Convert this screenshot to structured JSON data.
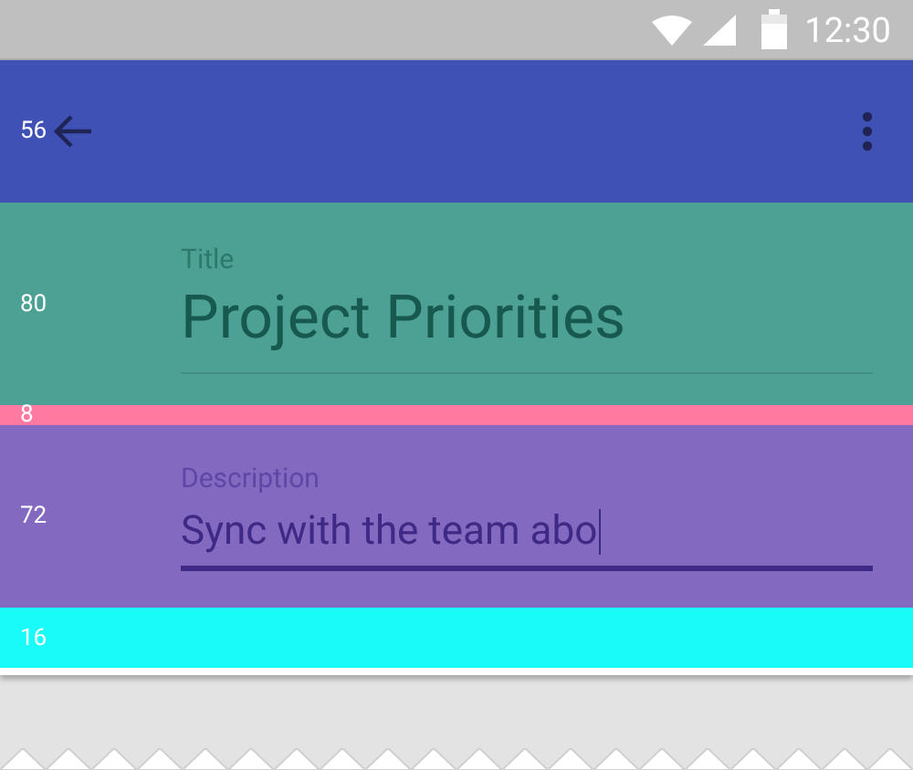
{
  "status_bar": {
    "time": "12:30"
  },
  "bands": [
    {
      "kind": "toolbar",
      "measure": "56",
      "color": "#3f51b5"
    },
    {
      "kind": "title-field",
      "measure": "80",
      "color": "#4ca194",
      "label": "Title",
      "value": "Project Priorities",
      "focused": false
    },
    {
      "kind": "gap",
      "measure": "8",
      "color": "#ff79a1"
    },
    {
      "kind": "text-field",
      "measure": "72",
      "color": "#8369bf",
      "label": "Description",
      "value": "Sync with the team abo",
      "focused": true
    },
    {
      "kind": "margin",
      "measure": "16",
      "color": "#18fbf8"
    }
  ]
}
